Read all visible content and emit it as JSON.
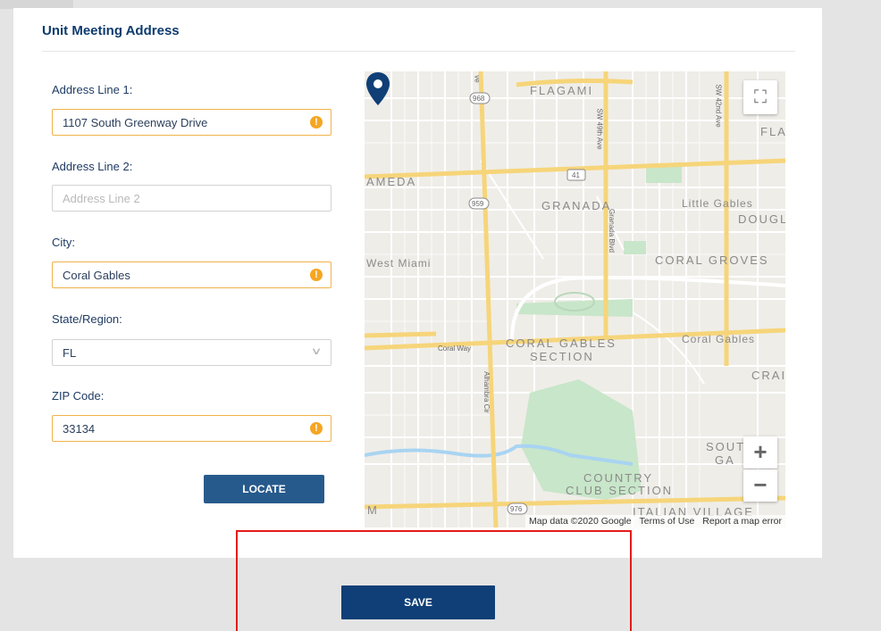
{
  "section": {
    "title": "Unit Meeting Address"
  },
  "form": {
    "address1": {
      "label": "Address Line 1",
      "value": "1107 South Greenway Drive",
      "warning": true
    },
    "address2": {
      "label": "Address Line 2",
      "placeholder": "Address Line 2"
    },
    "city": {
      "label": "City",
      "value": "Coral Gables",
      "warning": true
    },
    "state": {
      "label": "State/Region",
      "value": "FL"
    },
    "zip": {
      "label": "ZIP Code",
      "value": "33134",
      "warning": true
    },
    "label_suffix": ":",
    "warning_glyph": "!"
  },
  "buttons": {
    "locate": "LOCATE",
    "save": "SAVE"
  },
  "map": {
    "labels": {
      "flagami": "FLAGAMI",
      "ameda": "AMEDA",
      "granada": "GRANADA",
      "little_gables": "Little Gables",
      "dougl": "DOUGL",
      "west_miami": "West Miami",
      "coral_groves": "CORAL GROVES",
      "coral_way": "Coral Way",
      "coral_gables_section_1": "CORAL GABLES",
      "coral_gables_section_2": "SECTION",
      "coral_gables": "Coral Gables",
      "crai": "CRAI",
      "south_ga_1": "SOUT",
      "south_ga_2": "GA",
      "country_club_1": "COUNTRY",
      "country_club_2": "CLUB SECTION",
      "fla": "FLA",
      "sw49": "SW 49th Ave",
      "sw42": "SW 42nd Ave",
      "granada_blvd": "Granada Blvd",
      "alhambra": "Alhambra Cir",
      "shield_968": "968",
      "shield_41": "41",
      "shield_959": "959",
      "shield_976": "976",
      "m_left": "M",
      "ve": "ve",
      "italian_village": "ITALIAN VILLAGE"
    },
    "attribution": {
      "data": "Map data ©2020 Google",
      "terms": "Terms of Use",
      "report": "Report a map error"
    },
    "controls": {
      "zoom_in": "+",
      "zoom_out": "−"
    },
    "colors": {
      "park": "#c8e6c9",
      "water": "#a8d4f2",
      "highway": "#f6d57a",
      "road": "#ffffff",
      "pin": "#0f3f76"
    }
  },
  "colors": {
    "accent": "#0f3f76",
    "warning": "#f5a623",
    "highlight": "#e31b1b"
  }
}
